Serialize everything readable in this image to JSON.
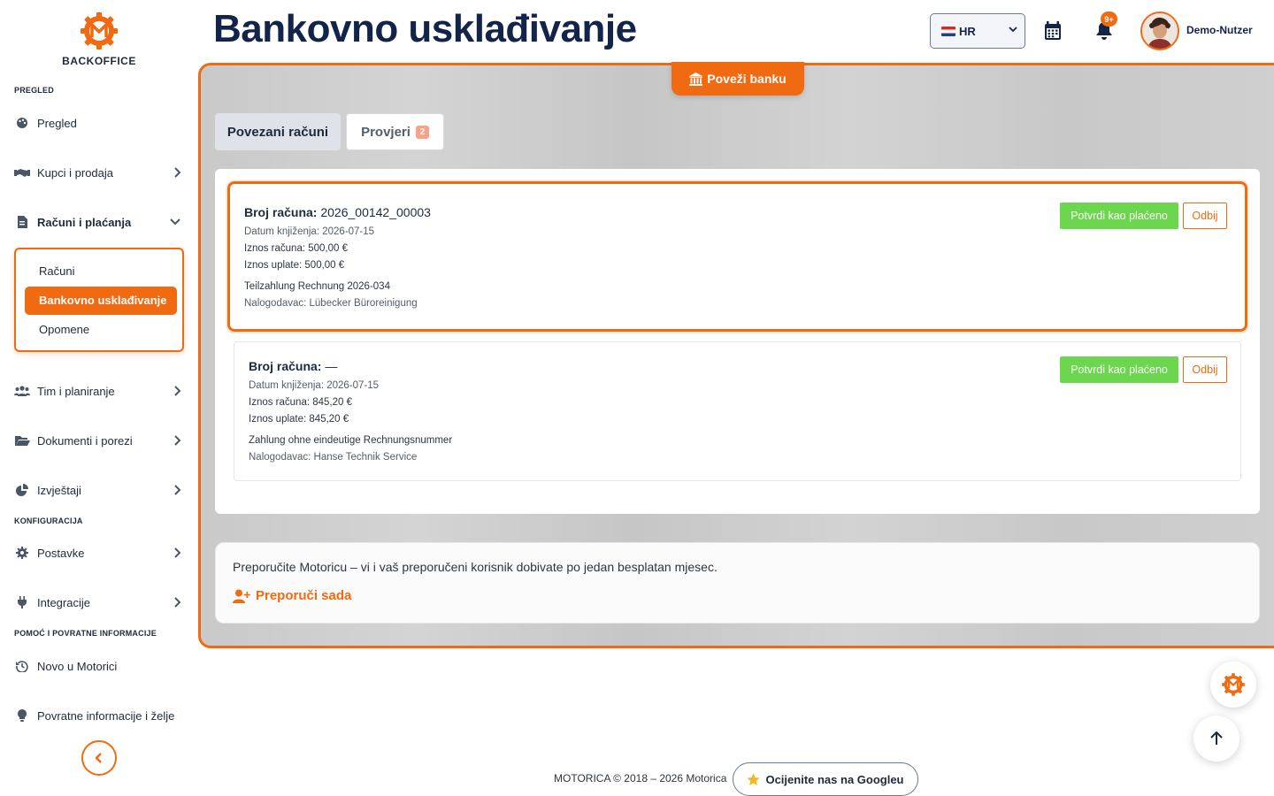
{
  "brand": {
    "logo_text": "BACKOFFICE",
    "accent_color": "#f06a12"
  },
  "sidebar": {
    "sections": {
      "overview": "PREGLED",
      "configuration": "KONFIGURACIJA",
      "help": "POMOĆ I POVRATNE INFORMACIJE"
    },
    "items": {
      "overview": "Pregled",
      "customers_sales": "Kupci i prodaja",
      "invoices_payments": "Računi i plaćanja",
      "team_planning": "Tim i planiranje",
      "documents_taxes": "Dokumenti i porezi",
      "reports": "Izvještaji",
      "settings": "Postavke",
      "integrations": "Integracije",
      "new_in_motorica": "Novo u Motorici",
      "feedback": "Povratne informacije i želje"
    },
    "submenu": {
      "invoices": "Računi",
      "bank_reconciliation": "Bankovno usklađivanje",
      "reminders": "Opomene"
    }
  },
  "header": {
    "title": "Bankovno usklađivanje",
    "language": "HR",
    "notifications_badge": "9+",
    "user_name": "Demo-Nutzer"
  },
  "main": {
    "connect_bank_label": "Poveži banku",
    "tabs": {
      "accounts": "Povezani računi",
      "review": "Provjeri",
      "review_count": "2"
    },
    "entries": [
      {
        "invoice_label": "Broj računa:",
        "invoice_number": "2026_00142_00003",
        "booking_date": "Datum knjiženja: 2026-07-15",
        "invoice_amount": "Iznos računa: 500,00 €",
        "payment_amount": "Iznos uplate: 500,00 €",
        "reference": "Teilzahlung Rechnung 2026-034",
        "payer": "Nalogodavac: Lübecker Büroreinigung",
        "confirm_label": "Potvrdi kao plaćeno",
        "reject_label": "Odbij"
      },
      {
        "invoice_label": "Broj računa:",
        "invoice_number": "—",
        "booking_date": "Datum knjiženja: 2026-07-15",
        "invoice_amount": "Iznos računa: 845,20 €",
        "payment_amount": "Iznos uplate: 845,20 €",
        "reference": "Zahlung ohne eindeutige Rechnungsnummer",
        "payer": "Nalogodavac: Hanse Technik Service",
        "confirm_label": "Potvrdi kao plaćeno",
        "reject_label": "Odbij"
      }
    ],
    "referral": {
      "text": "Preporučite Motoricu – vi i vaš preporučeni korisnik dobivate po jedan besplatan mjesec.",
      "link_label": "Preporuči sada"
    }
  },
  "footer": {
    "copyright": "MOTORICA © 2018 – 2026 Motorica",
    "rate_label": "Ocijenite nas na Googleu"
  }
}
